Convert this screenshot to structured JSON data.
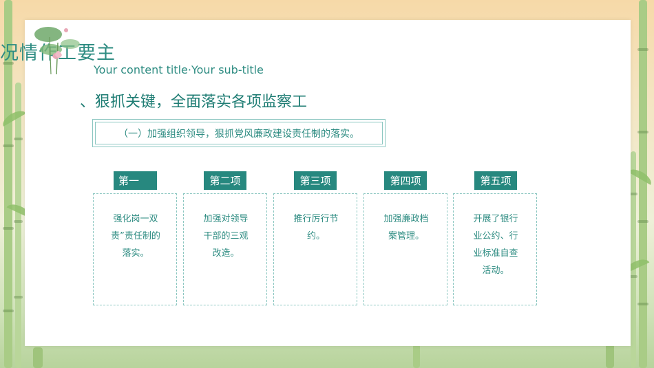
{
  "header": {
    "title": "况情作工要主",
    "subtitle": "Your content title·Your sub-title"
  },
  "section": {
    "title": "、狠抓关键，全面落实各项监察工",
    "topic": "（一）加强组织领导，狠抓党风廉政建设责任制的落实。"
  },
  "items": [
    {
      "label": "第一",
      "text": "强化岗一双责”责任制的落实。"
    },
    {
      "label": "第二项",
      "text": "加强对领导干部的三观改造。"
    },
    {
      "label": "第三项",
      "text": "推行厉行节约。"
    },
    {
      "label": "第四项",
      "text": "加强廉政档案管理。"
    },
    {
      "label": "第五项",
      "text": "开展了银行业公约、行业标准自查活动。"
    }
  ],
  "colors": {
    "accent": "#27887f",
    "text": "#2e8c82",
    "border": "#8cc7c1"
  },
  "icons": [
    "lotus-illustration",
    "bamboo-decoration"
  ]
}
